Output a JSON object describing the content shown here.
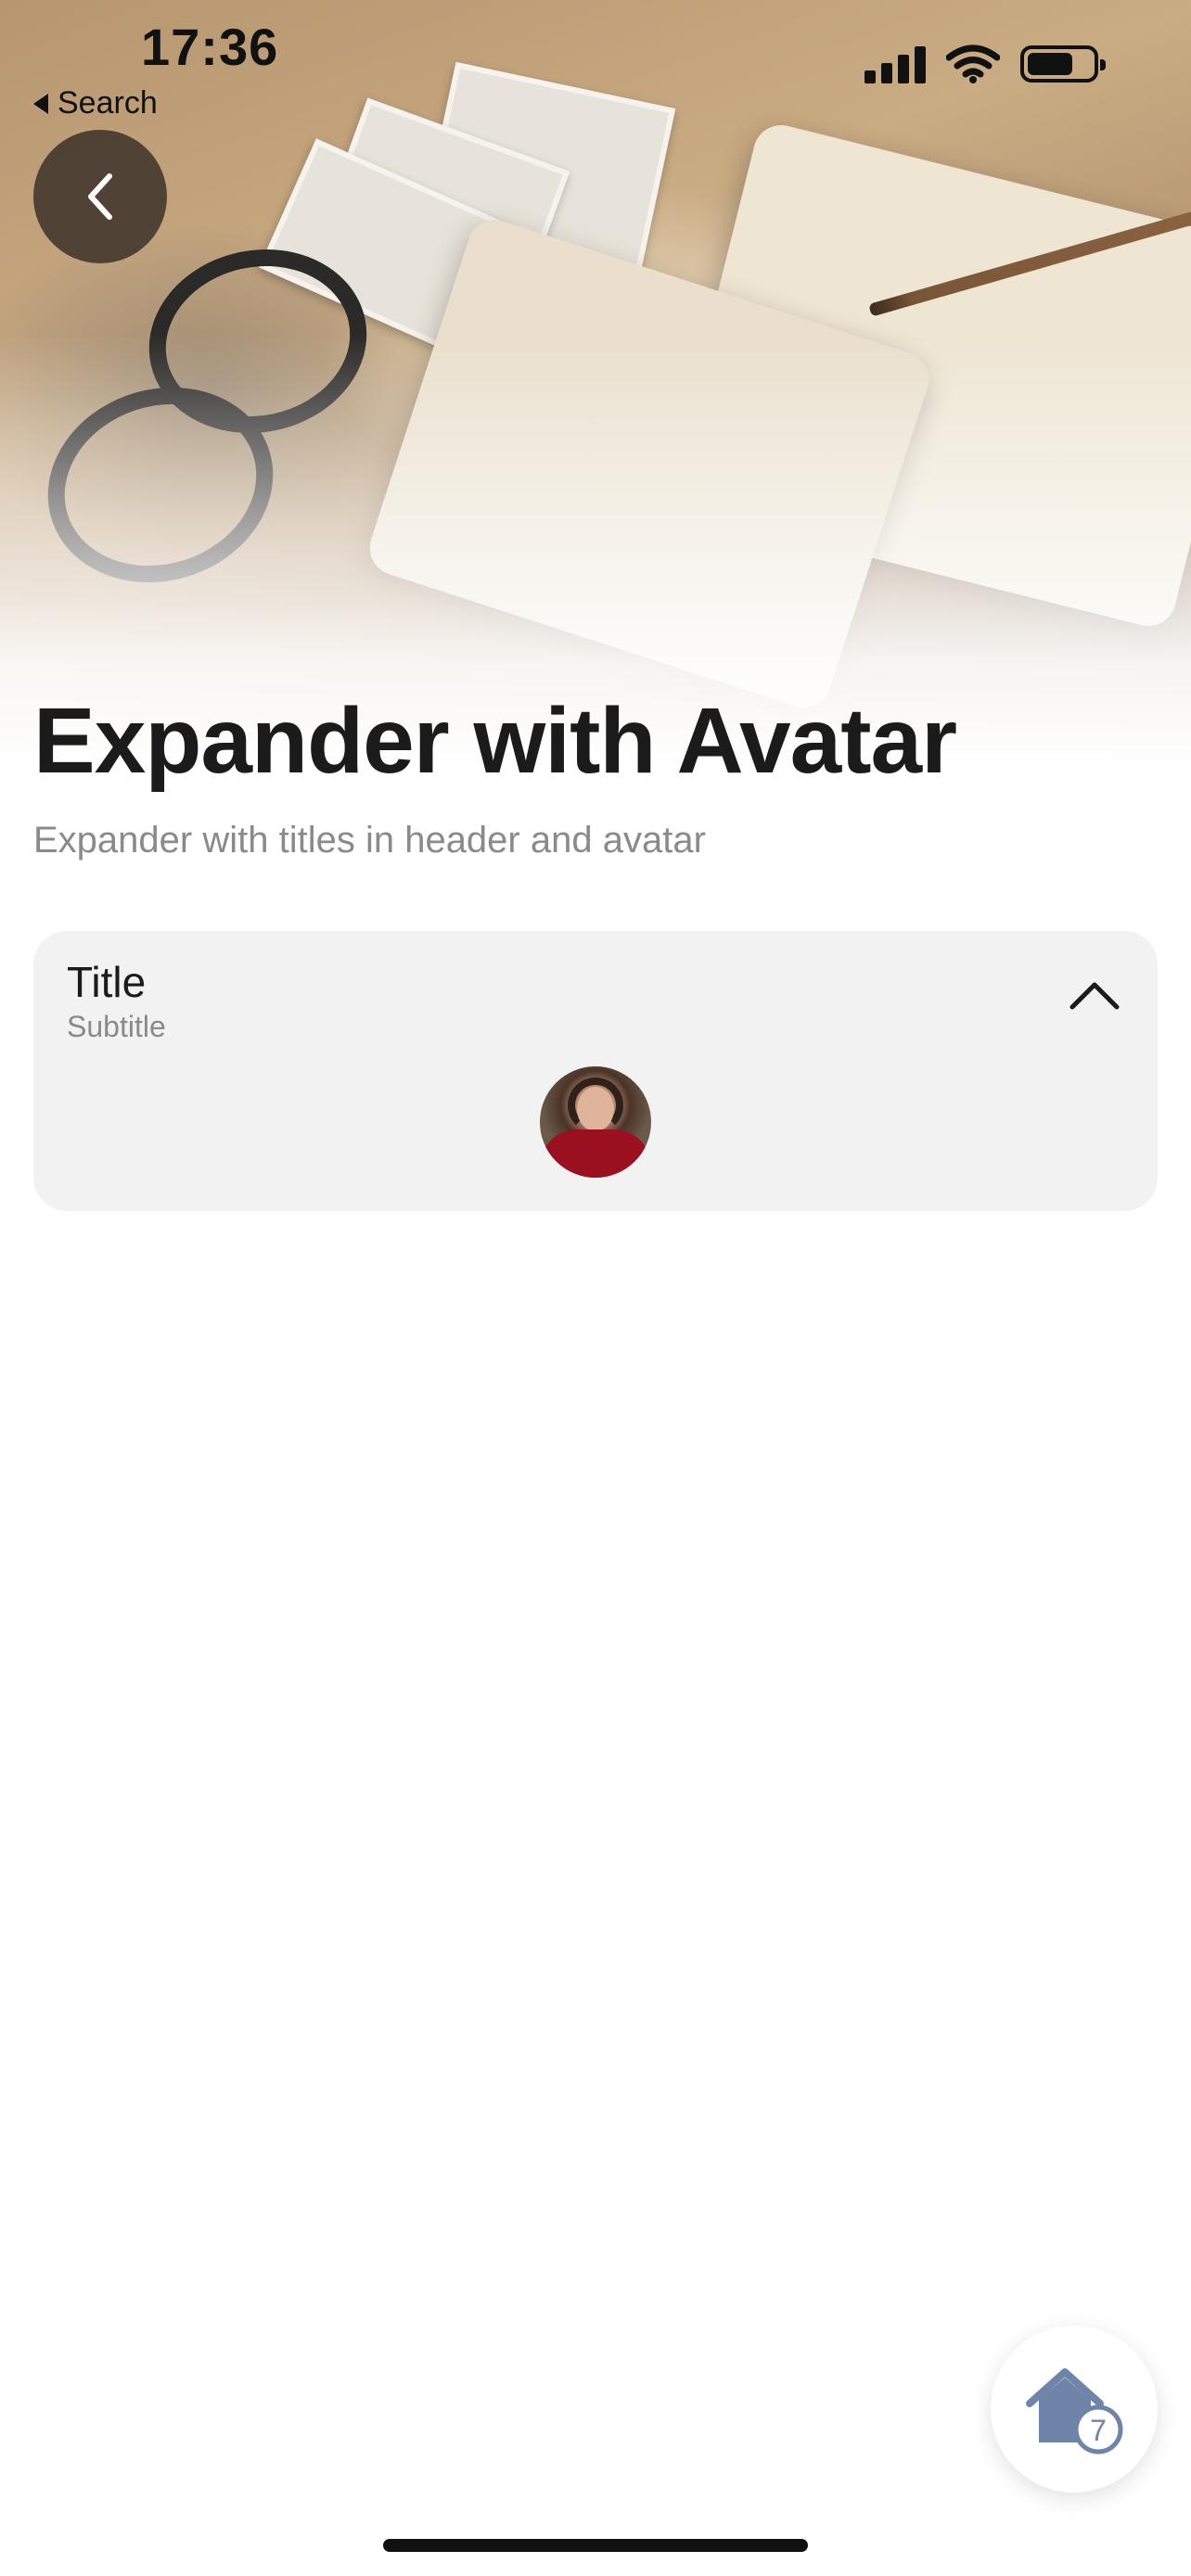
{
  "status_bar": {
    "time": "17:36",
    "back_app_label": "Search",
    "icons": [
      "cellular-signal-icon",
      "wifi-icon",
      "battery-icon"
    ]
  },
  "header": {
    "back_icon": "chevron-left-icon",
    "title": "Expander with Avatar",
    "subtitle": "Expander with titles in header and avatar"
  },
  "expander": {
    "title": "Title",
    "subtitle": "Subtitle",
    "state_icon": "chevron-up-icon",
    "avatar": "avatar-photo"
  },
  "fab": {
    "icon": "home-icon",
    "badge": "7"
  },
  "colors": {
    "title": "#1b1b1b",
    "muted": "#8a8a8a",
    "card_bg": "#f2f2f2",
    "accent_home": "#6e84a8"
  }
}
